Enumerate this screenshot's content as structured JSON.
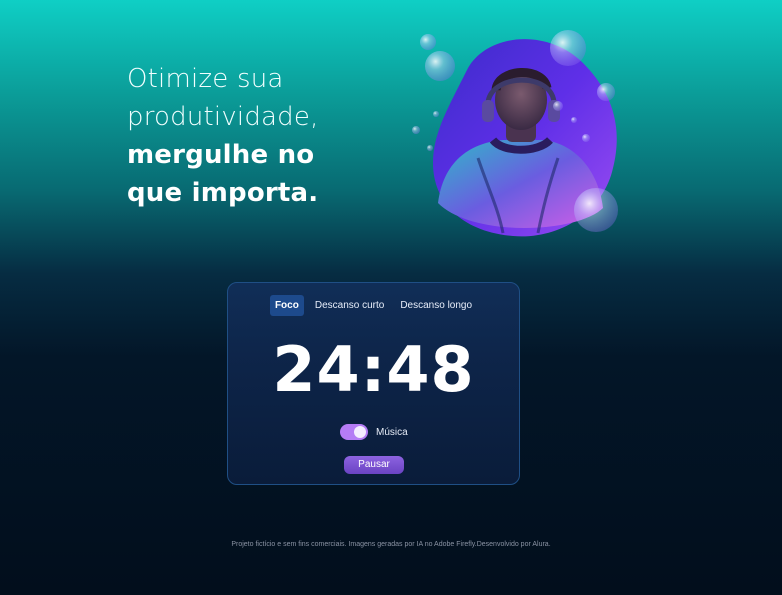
{
  "hero": {
    "line1": "Otimize sua",
    "line2": "produtividade,",
    "line3": "mergulhe no",
    "line4": "que importa."
  },
  "illustration": {
    "subject": "person-with-headphones",
    "accent_colors": [
      "#6a2ff0",
      "#2b1fa6",
      "#e55cf0",
      "#3ec3d9"
    ]
  },
  "timer_card": {
    "tabs": [
      {
        "label": "Foco",
        "active": true
      },
      {
        "label": "Descanso curto",
        "active": false
      },
      {
        "label": "Descanso longo",
        "active": false
      }
    ],
    "time": "24:48",
    "music": {
      "label": "Música",
      "enabled": true
    },
    "pause_label": "Pausar"
  },
  "footer": {
    "text": "Projeto fictício e sem fins comerciais. Imagens geradas por IA no Adobe Firefly.Desenvolvido por Alura."
  },
  "colors": {
    "accent_purple": "#b57cf5",
    "button_purple": "#7a52d4",
    "active_tab": "#1d4a8c",
    "card_border": "#1f4f85"
  }
}
